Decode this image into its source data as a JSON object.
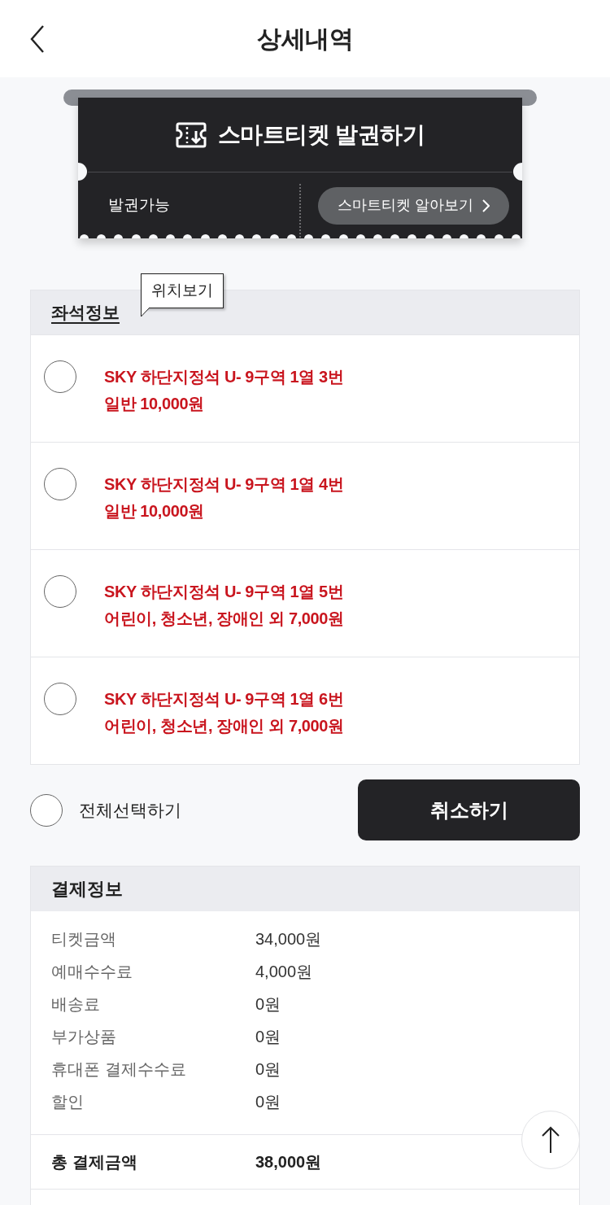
{
  "header": {
    "title": "상세내역"
  },
  "smart_ticket": {
    "title": "스마트티켓 발권하기",
    "status": "발권가능",
    "info_button": "스마트티켓 알아보기"
  },
  "seat_info": {
    "title": "좌석정보",
    "tooltip": "위치보기",
    "seats": [
      {
        "seat": "SKY 하단지정석 U- 9구역 1열 3번",
        "price": "일반 10,000원",
        "selected": false
      },
      {
        "seat": "SKY 하단지정석 U- 9구역 1열 4번",
        "price": "일반 10,000원",
        "selected": false
      },
      {
        "seat": "SKY 하단지정석 U- 9구역 1열 5번",
        "price": "어린이, 청소년, 장애인 외 7,000원",
        "selected": false
      },
      {
        "seat": "SKY 하단지정석 U- 9구역 1열 6번",
        "price": "어린이, 청소년, 장애인 외 7,000원",
        "selected": false
      }
    ]
  },
  "select_all": {
    "label": "전체선택하기",
    "checked": false
  },
  "cancel_button": "취소하기",
  "payment": {
    "title": "결제정보",
    "rows": [
      {
        "label": "티켓금액",
        "value": "34,000원"
      },
      {
        "label": "예매수수료",
        "value": "4,000원"
      },
      {
        "label": "배송료",
        "value": "0원"
      },
      {
        "label": "부가상품",
        "value": "0원"
      },
      {
        "label": "휴대폰 결제수수료",
        "value": "0원"
      },
      {
        "label": "할인",
        "value": "0원"
      }
    ],
    "total": {
      "label": "총 결제금액",
      "value": "38,000원"
    }
  }
}
